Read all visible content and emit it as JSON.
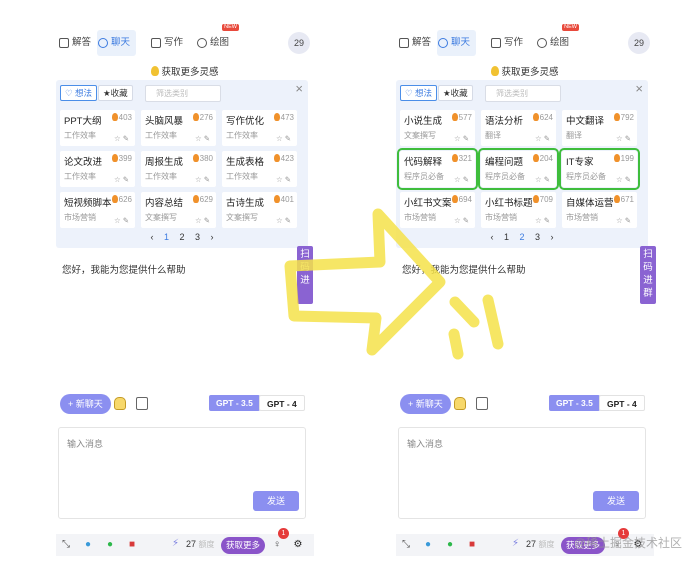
{
  "colors": {
    "accent": "#8b8ff0",
    "active_tab": "#3c7be0",
    "highlight": "#3fbd3c",
    "arrow": "#f5e24a",
    "promo": "#8a54c9",
    "panel_bg": "#edf2fb"
  },
  "nav": {
    "tabs": [
      {
        "label": "解答",
        "icon": "chat-answer-icon"
      },
      {
        "label": "聊天",
        "icon": "chat-bubble-icon"
      },
      {
        "label": "写作",
        "icon": "write-icon"
      },
      {
        "label": "绘图",
        "icon": "palette-icon"
      }
    ],
    "new_badge": "NEW",
    "counter": "29"
  },
  "inspire": "获取更多灵感",
  "filters": {
    "idea": "想法",
    "fav": "收藏",
    "select_placeholder": "筛选类别"
  },
  "left_prompts": [
    {
      "title": "PPT大纲",
      "count": "403",
      "category": "工作效率"
    },
    {
      "title": "头脑风暴",
      "count": "276",
      "category": "工作效率"
    },
    {
      "title": "写作优化",
      "count": "473",
      "category": "工作效率"
    },
    {
      "title": "论文改进",
      "count": "399",
      "category": "工作效率"
    },
    {
      "title": "周报生成",
      "count": "380",
      "category": "工作效率"
    },
    {
      "title": "生成表格",
      "count": "423",
      "category": "工作效率"
    },
    {
      "title": "短视频脚本",
      "count": "626",
      "category": "市场营销"
    },
    {
      "title": "内容总结",
      "count": "629",
      "category": "文案撰写"
    },
    {
      "title": "古诗生成",
      "count": "401",
      "category": "文案撰写"
    }
  ],
  "right_prompts": [
    {
      "title": "小说生成",
      "count": "577",
      "category": "文案撰写"
    },
    {
      "title": "语法分析",
      "count": "624",
      "category": "翻译"
    },
    {
      "title": "中文翻译",
      "count": "792",
      "category": "翻译"
    },
    {
      "title": "代码解释",
      "count": "321",
      "category": "程序员必备"
    },
    {
      "title": "编程问题",
      "count": "204",
      "category": "程序员必备"
    },
    {
      "title": "IT专家",
      "count": "199",
      "category": "程序员必备"
    },
    {
      "title": "小红书文案",
      "count": "694",
      "category": "市场营销"
    },
    {
      "title": "小红书标题",
      "count": "709",
      "category": "市场营销"
    },
    {
      "title": "自媒体运营",
      "count": "671",
      "category": "市场营销"
    }
  ],
  "pager": {
    "prev": "‹",
    "pages": [
      "1",
      "2",
      "3"
    ],
    "next": "›",
    "left_current": "1",
    "right_current": "2"
  },
  "greeting": "您好，我能为您提供什么帮助",
  "scan": {
    "left": "扫码进",
    "right": "扫码进群"
  },
  "toolbar": {
    "new_chat": "+ 新聊天",
    "gpt35": "GPT - 3.5",
    "gpt4": "GPT - 4"
  },
  "input": {
    "placeholder": "输入消息",
    "send": "发送"
  },
  "bottom": {
    "points": "27",
    "points_unit": "额度",
    "get_more": "获取更多",
    "notif": "1",
    "icons": [
      "collapse-icon",
      "twitter-icon",
      "wechat-icon",
      "gift-icon",
      "bulb-icon",
      "gear-icon"
    ]
  },
  "watermark": "@稀土掘金技术社区"
}
